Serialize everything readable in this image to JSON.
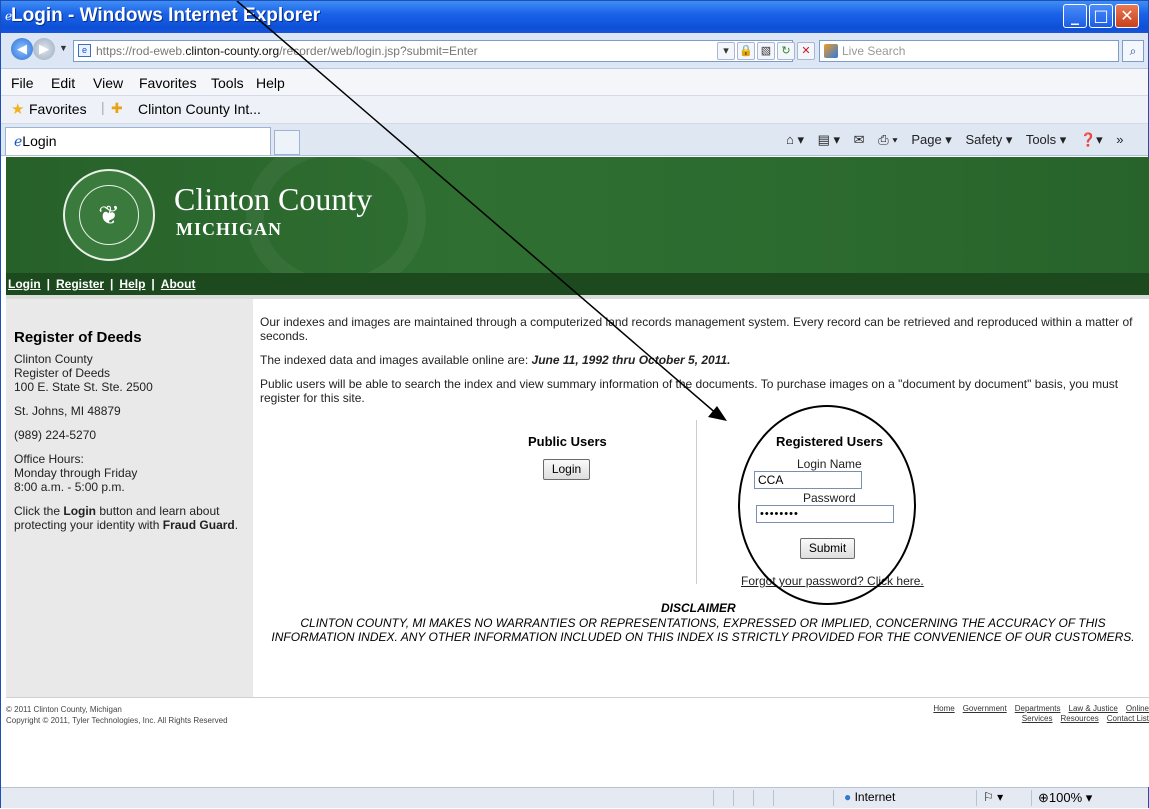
{
  "window": {
    "title": "Login - Windows Internet Explorer"
  },
  "address": {
    "url_prefix": "https://rod-eweb.",
    "url_host": "clinton-county.org",
    "url_path": "/recorder/web/login.jsp?submit=Enter",
    "search_placeholder": "Live Search"
  },
  "menu": [
    "File",
    "Edit",
    "View",
    "Favorites",
    "Tools",
    "Help"
  ],
  "favorites": {
    "label": "Favorites",
    "link": "Clinton County Int..."
  },
  "tab": {
    "title": "Login"
  },
  "commandbar": {
    "page": "Page ▾",
    "safety": "Safety ▾",
    "tools": "Tools ▾"
  },
  "banner": {
    "name": "Clinton County",
    "sub": "MICHIGAN"
  },
  "nav": {
    "login": "Login",
    "register": "Register",
    "help": "Help",
    "about": "About"
  },
  "sidebar": {
    "title": "Register of Deeds",
    "address1": "Clinton County",
    "address2": "Register of Deeds",
    "address3": "100 E. State St. Ste. 2500",
    "city": "St. Johns, MI 48879",
    "phone": "(989) 224-5270",
    "hours1": "Office Hours:",
    "hours2": "Monday through Friday",
    "hours3": "8:00 a.m. - 5:00 p.m.",
    "fraud1": "Click the ",
    "fraud_login": "Login",
    "fraud2": " button and learn about protecting your identity with ",
    "fraud_guard": "Fraud Guard",
    "fraud3": "."
  },
  "main": {
    "p1": "Our indexes and images are maintained through a computerized land records management system. Every record can be retrieved and reproduced within a matter of seconds.",
    "p2_pre": "The indexed data and images available online are: ",
    "p2_dates": "June 11, 1992 thru October 5, 2011.",
    "p3": "Public users will be able to search the index and view summary information of the documents. To purchase images on a \"document by document\" basis, you must register for this site."
  },
  "public": {
    "heading": "Public Users",
    "login_button": "Login"
  },
  "registered": {
    "heading": "Registered Users",
    "login_name_label": "Login Name",
    "login_name_value": "CCA",
    "password_label": "Password",
    "password_value": "••••••••",
    "submit": "Submit",
    "forgot": "Forgot your password? Click here."
  },
  "disclaimer": {
    "title": "DISCLAIMER",
    "text": "CLINTON COUNTY, MI MAKES NO WARRANTIES OR REPRESENTATIONS, EXPRESSED OR IMPLIED, CONCERNING THE ACCURACY OF THIS INFORMATION INDEX. ANY OTHER INFORMATION INCLUDED ON THIS INDEX IS STRICTLY PROVIDED FOR THE CONVENIENCE OF OUR CUSTOMERS."
  },
  "footer": {
    "copy1": "© 2011 Clinton County, Michigan",
    "copy2": "Copyright © 2011, Tyler Technologies, Inc. All Rights Reserved",
    "links_row1": [
      "Home",
      "Government",
      "Departments",
      "Law & Justice",
      "Online"
    ],
    "links_row2": [
      "Services",
      "Resources",
      "Contact List"
    ]
  },
  "status": {
    "zone": "Internet",
    "zoom": "100%"
  }
}
